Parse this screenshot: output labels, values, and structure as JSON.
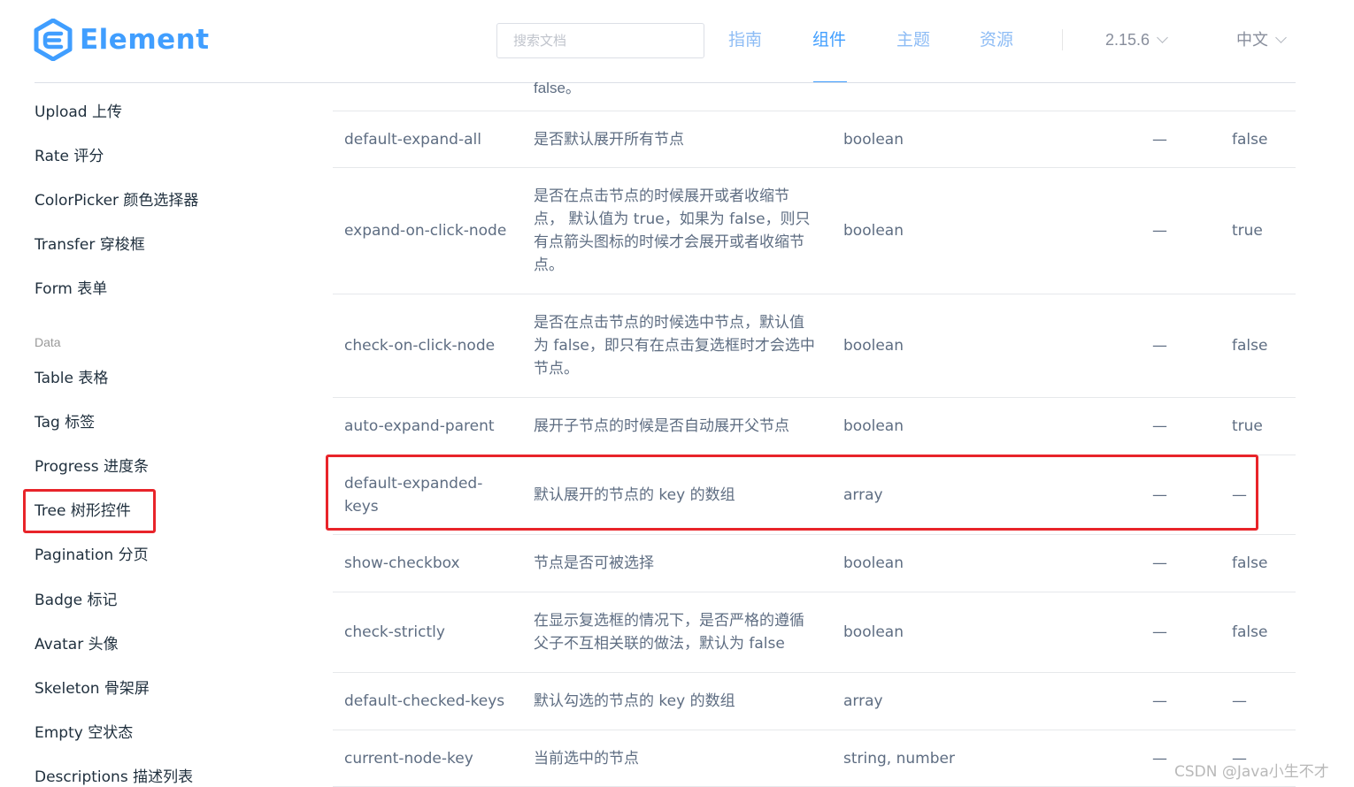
{
  "header": {
    "logo_text": "Element",
    "search_placeholder": "搜索文档",
    "nav": [
      {
        "label": "指南",
        "active": false
      },
      {
        "label": "组件",
        "active": true
      },
      {
        "label": "主题",
        "active": false
      },
      {
        "label": "资源",
        "active": false
      }
    ],
    "version": "2.15.6",
    "language": "中文"
  },
  "sidebar": {
    "items": [
      {
        "label": "Upload 上传"
      },
      {
        "label": "Rate 评分"
      },
      {
        "label": "ColorPicker 颜色选择器"
      },
      {
        "label": "Transfer 穿梭框"
      },
      {
        "label": "Form 表单"
      },
      {
        "group": "Data"
      },
      {
        "label": "Table 表格"
      },
      {
        "label": "Tag 标签"
      },
      {
        "label": "Progress 进度条"
      },
      {
        "label": "Tree 树形控件",
        "highlighted": true
      },
      {
        "label": "Pagination 分页"
      },
      {
        "label": "Badge 标记"
      },
      {
        "label": "Avatar 头像"
      },
      {
        "label": "Skeleton 骨架屏"
      },
      {
        "label": "Empty 空状态"
      },
      {
        "label": "Descriptions 描述列表"
      }
    ]
  },
  "table": {
    "partial_top_text": "false。",
    "rows": [
      {
        "name": "default-expand-all",
        "desc": "是否默认展开所有节点",
        "type": "boolean",
        "options": "—",
        "default": "false"
      },
      {
        "name": "expand-on-click-node",
        "desc": "是否在点击节点的时候展开或者收缩节点， 默认值为 true，如果为 false，则只有点箭头图标的时候才会展开或者收缩节点。",
        "type": "boolean",
        "options": "—",
        "default": "true"
      },
      {
        "name": "check-on-click-node",
        "desc": "是否在点击节点的时候选中节点，默认值为 false，即只有在点击复选框时才会选中节点。",
        "type": "boolean",
        "options": "—",
        "default": "false"
      },
      {
        "name": "auto-expand-parent",
        "desc": "展开子节点的时候是否自动展开父节点",
        "type": "boolean",
        "options": "—",
        "default": "true"
      },
      {
        "name": "default-expanded-keys",
        "desc": "默认展开的节点的 key 的数组",
        "type": "array",
        "options": "—",
        "default": "—",
        "highlighted": true
      },
      {
        "name": "show-checkbox",
        "desc": "节点是否可被选择",
        "type": "boolean",
        "options": "—",
        "default": "false"
      },
      {
        "name": "check-strictly",
        "desc": "在显示复选框的情况下，是否严格的遵循父子不互相关联的做法，默认为 false",
        "type": "boolean",
        "options": "—",
        "default": "false"
      },
      {
        "name": "default-checked-keys",
        "desc": "默认勾选的节点的 key 的数组",
        "type": "array",
        "options": "—",
        "default": "—"
      },
      {
        "name": "current-node-key",
        "desc": "当前选中的节点",
        "type": "string, number",
        "options": "—",
        "default": "—"
      }
    ]
  },
  "watermark": "CSDN @Java小生不才",
  "colors": {
    "brand": "#409eff",
    "highlight_border": "#e8242a",
    "text": "#5e6d82",
    "sidebar_text": "#1f2f3d"
  }
}
